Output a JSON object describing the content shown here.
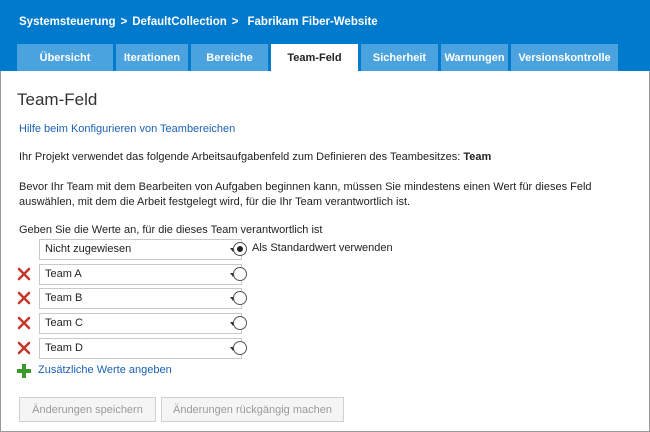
{
  "header": {
    "crumbs": [
      "Systemsteuerung",
      "DefaultCollection"
    ],
    "separator": ">",
    "project": "Fabrikam Fiber-Website"
  },
  "tabs": [
    {
      "label": "Übersicht"
    },
    {
      "label": "Iterationen"
    },
    {
      "label": "Bereiche"
    },
    {
      "label": "Team-Feld"
    },
    {
      "label": "Sicherheit"
    },
    {
      "label": "Warnungen"
    },
    {
      "label": "Versionskontrolle"
    }
  ],
  "active_tab": "Team-Feld",
  "main": {
    "title": "Team-Feld",
    "help_link": "Hilfe beim Konfigurieren von Teambereichen",
    "intro_text": "Ihr Projekt verwendet das folgende Arbeitsaufgabenfeld zum Definieren des Teambesitzes:",
    "intro_field": "Team",
    "description": "Bevor Ihr Team mit dem Bearbeiten von Aufgaben beginnen kann, müssen Sie mindestens einen Wert für dieses Feld auswählen, mit dem die Arbeit festgelegt wird, für die Ihr Team verantwortlich ist.",
    "prompt": "Geben Sie die Werte an, für die dieses Team verantwortlich ist",
    "values": [
      {
        "value": "Nicht zugewiesen",
        "default": true,
        "removable": false
      },
      {
        "value": "Team A",
        "default": false,
        "removable": true
      },
      {
        "value": "Team B",
        "default": false,
        "removable": true
      },
      {
        "value": "Team C",
        "default": false,
        "removable": true
      },
      {
        "value": "Team D",
        "default": false,
        "removable": true
      }
    ],
    "default_label": "Als Standardwert verwenden",
    "add_values_label": "Zusätzliche Werte angeben",
    "save_label": "Änderungen speichern",
    "undo_label": "Änderungen rückgängig machen"
  },
  "colors": {
    "header": "#007acc",
    "tab_inactive": "#4aa3df",
    "link": "#1a62b7",
    "delete": "#c0392b",
    "add": "#3b9a2c"
  },
  "icons": {
    "delete": "red-x-icon",
    "add": "green-plus-icon",
    "dropdown": "chevron-down-icon"
  }
}
